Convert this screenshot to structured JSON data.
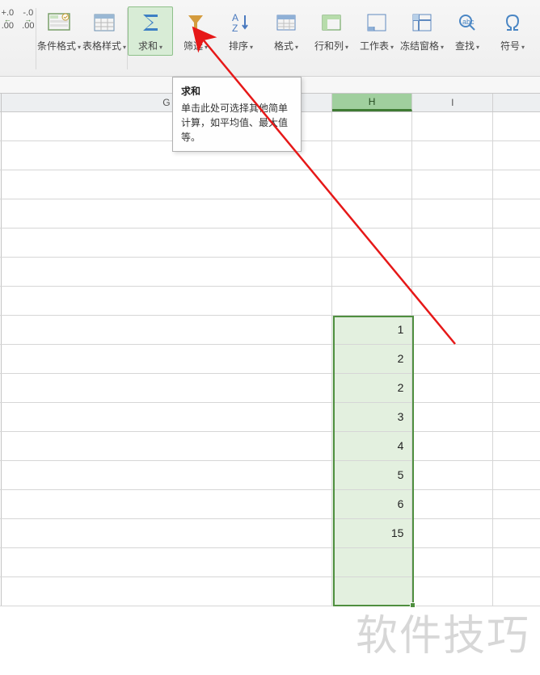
{
  "ribbon": {
    "decimals": {
      "inc": "+.0",
      "dec": "-.0",
      "sub": ".00"
    },
    "cond_format": "条件格式",
    "table_style": "表格样式",
    "sum": "求和",
    "filter": "筛选",
    "sort": "排序",
    "format": "格式",
    "rowcol": "行和列",
    "worksheet": "工作表",
    "freeze": "冻结窗格",
    "find": "查找",
    "symbol": "符号"
  },
  "tooltip": {
    "title": "求和",
    "body": "单击此处可选择其他简单计算，如平均值、最大值等。"
  },
  "columns": {
    "g": "G",
    "h": "H",
    "i": "I"
  },
  "cells": {
    "h": [
      "1",
      "2",
      "2",
      "3",
      "4",
      "5",
      "6",
      "15"
    ]
  },
  "layout": {
    "blank_rows_before": 7,
    "blank_rows_after": 2,
    "selection": {
      "top_row": 7,
      "rows": 10
    }
  },
  "watermark": "软件技巧"
}
